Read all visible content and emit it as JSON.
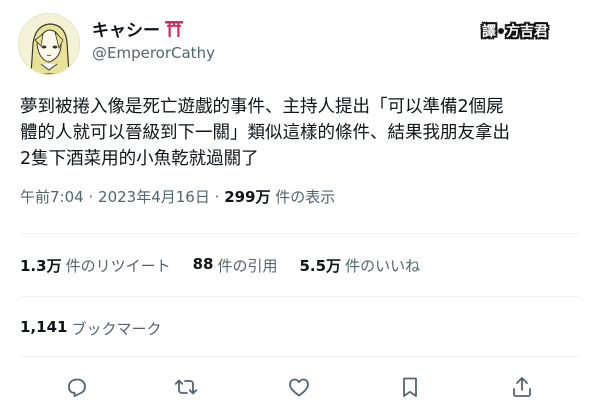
{
  "author": {
    "display_name": "キャシー",
    "name_emoji_icon": "torii-gate-icon",
    "handle": "@EmperorCathy",
    "avatar_icon": "anime-girl-avatar-icon"
  },
  "watermark": {
    "left": "譯",
    "right": "方吉君"
  },
  "tweet": {
    "text": "夢到被捲入像是死亡遊戲的事件、主持人提出「可以準備2個屍\n體的人就可以晉級到下一關」類似這樣的條件、結果我朋友拿出\n2隻下酒菜用的小魚乾就過關了"
  },
  "meta": {
    "time": "午前7:04",
    "separator": "·",
    "date": "2023年4月16日",
    "views_count": "299万",
    "views_label": "件の表示"
  },
  "stats": [
    {
      "count": "1.3万",
      "label": "件のリツイート"
    },
    {
      "count": "88",
      "label": "件の引用"
    },
    {
      "count": "5.5万",
      "label": "件のいいね"
    }
  ],
  "bookmarks": {
    "count": "1,141",
    "label": "ブックマーク"
  },
  "actions": {
    "reply": "reply-icon",
    "retweet": "retweet-icon",
    "like": "heart-icon",
    "bookmark": "bookmark-icon",
    "share": "share-icon"
  },
  "colors": {
    "text_primary": "#0f1419",
    "text_secondary": "#536471",
    "divider": "#eff3f4",
    "torii": "#e0245e"
  }
}
